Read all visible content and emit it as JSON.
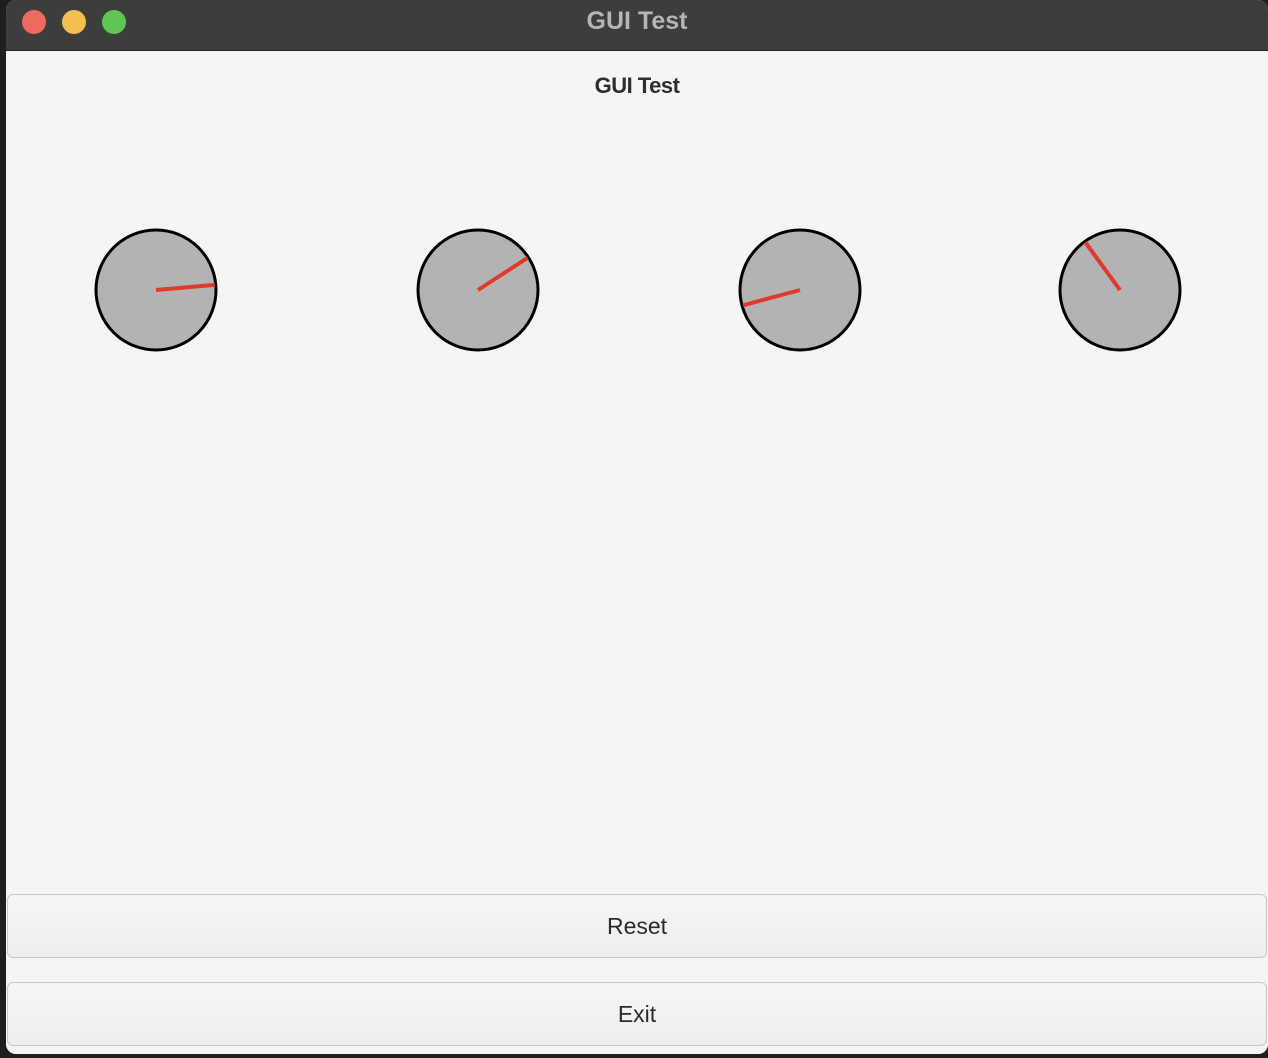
{
  "window": {
    "title": "GUI Test"
  },
  "content": {
    "heading": "GUI Test"
  },
  "dials": [
    {
      "name": "dial-1",
      "angle_deg": 5,
      "needle_color": "#e03a2e"
    },
    {
      "name": "dial-2",
      "angle_deg": 33,
      "needle_color": "#e03a2e"
    },
    {
      "name": "dial-3",
      "angle_deg": 195,
      "needle_color": "#e03a2e"
    },
    {
      "name": "dial-4",
      "angle_deg": 126,
      "needle_color": "#e03a2e"
    }
  ],
  "buttons": {
    "reset_label": "Reset",
    "exit_label": "Exit"
  },
  "colors": {
    "dial_face": "#b3b3b3",
    "dial_rim": "#000000",
    "titlebar": "#3d3d3d"
  }
}
